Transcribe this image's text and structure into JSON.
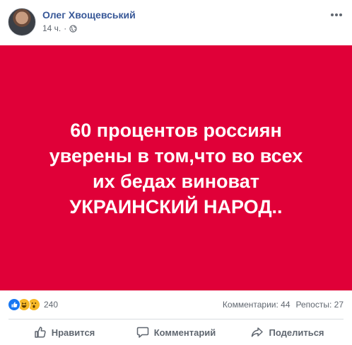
{
  "post": {
    "author": "Олег Хвощевський",
    "time": "14 ч.",
    "dot": "·",
    "image_lines": [
      "60 процентов россиян",
      "уверены в том,что во всех",
      "их бедах виноват",
      "УКРАИНСКИЙ НАРОД.."
    ],
    "image_color": "#e00038",
    "reaction_icons": [
      "like-icon",
      "haha-icon",
      "wow-icon"
    ],
    "reaction_count": "240",
    "comments_count": "Комментарии: 44",
    "shares_count": "Репосты: 27"
  },
  "actions": {
    "like_label": "Нравится",
    "comment_label": "Комментарий",
    "share_label": "Поделиться"
  },
  "colors": {
    "author_link": "#385898",
    "muted_text": "#606770",
    "like_blue": "#1877f2",
    "emoji_yellow": "#f7b928"
  }
}
